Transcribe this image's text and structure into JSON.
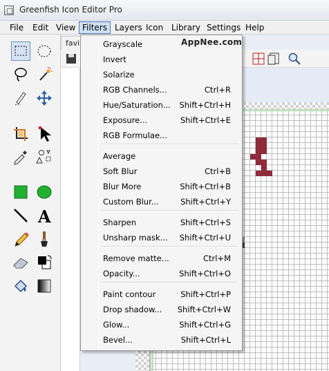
{
  "window": {
    "title": "Greenfish Icon Editor Pro"
  },
  "menubar": [
    "File",
    "Edit",
    "View",
    "Filters",
    "Layers",
    "Icon",
    "Library",
    "Settings",
    "Help"
  ],
  "document": {
    "tab_label": "favi"
  },
  "watermark": "AppNee.com",
  "filters_menu": {
    "items": [
      {
        "label": "Grayscale",
        "shortcut": ""
      },
      {
        "label": "Invert",
        "shortcut": ""
      },
      {
        "label": "Solarize",
        "shortcut": ""
      },
      {
        "label": "RGB Channels...",
        "shortcut": "Ctrl+R"
      },
      {
        "label": "Hue/Saturation...",
        "shortcut": "Shift+Ctrl+H"
      },
      {
        "label": "Exposure...",
        "shortcut": "Shift+Ctrl+E"
      },
      {
        "label": "RGB Formulae...",
        "shortcut": ""
      },
      {
        "label": "Average",
        "shortcut": ""
      },
      {
        "label": "Soft Blur",
        "shortcut": "Ctrl+B"
      },
      {
        "label": "Blur More",
        "shortcut": "Shift+Ctrl+B"
      },
      {
        "label": "Custom Blur...",
        "shortcut": "Shift+Ctrl+Y"
      },
      {
        "label": "Sharpen",
        "shortcut": "Shift+Ctrl+S"
      },
      {
        "label": "Unsharp mask...",
        "shortcut": "Shift+Ctrl+U"
      },
      {
        "label": "Remove matte...",
        "shortcut": "Ctrl+M"
      },
      {
        "label": "Opacity...",
        "shortcut": "Shift+Ctrl+O"
      },
      {
        "label": "Paint contour",
        "shortcut": "Shift+Ctrl+P"
      },
      {
        "label": "Drop shadow...",
        "shortcut": "Shift+Ctrl+W"
      },
      {
        "label": "Glow...",
        "shortcut": "Shift+Ctrl+G"
      },
      {
        "label": "Bevel...",
        "shortcut": "Shift+Ctrl+L"
      }
    ]
  },
  "colors": {
    "menu_highlight": "#cfe0f5",
    "menu_border": "#4d79b3",
    "canvas_blue": "#3b6f9a",
    "canvas_red": "#8f2b3a"
  }
}
